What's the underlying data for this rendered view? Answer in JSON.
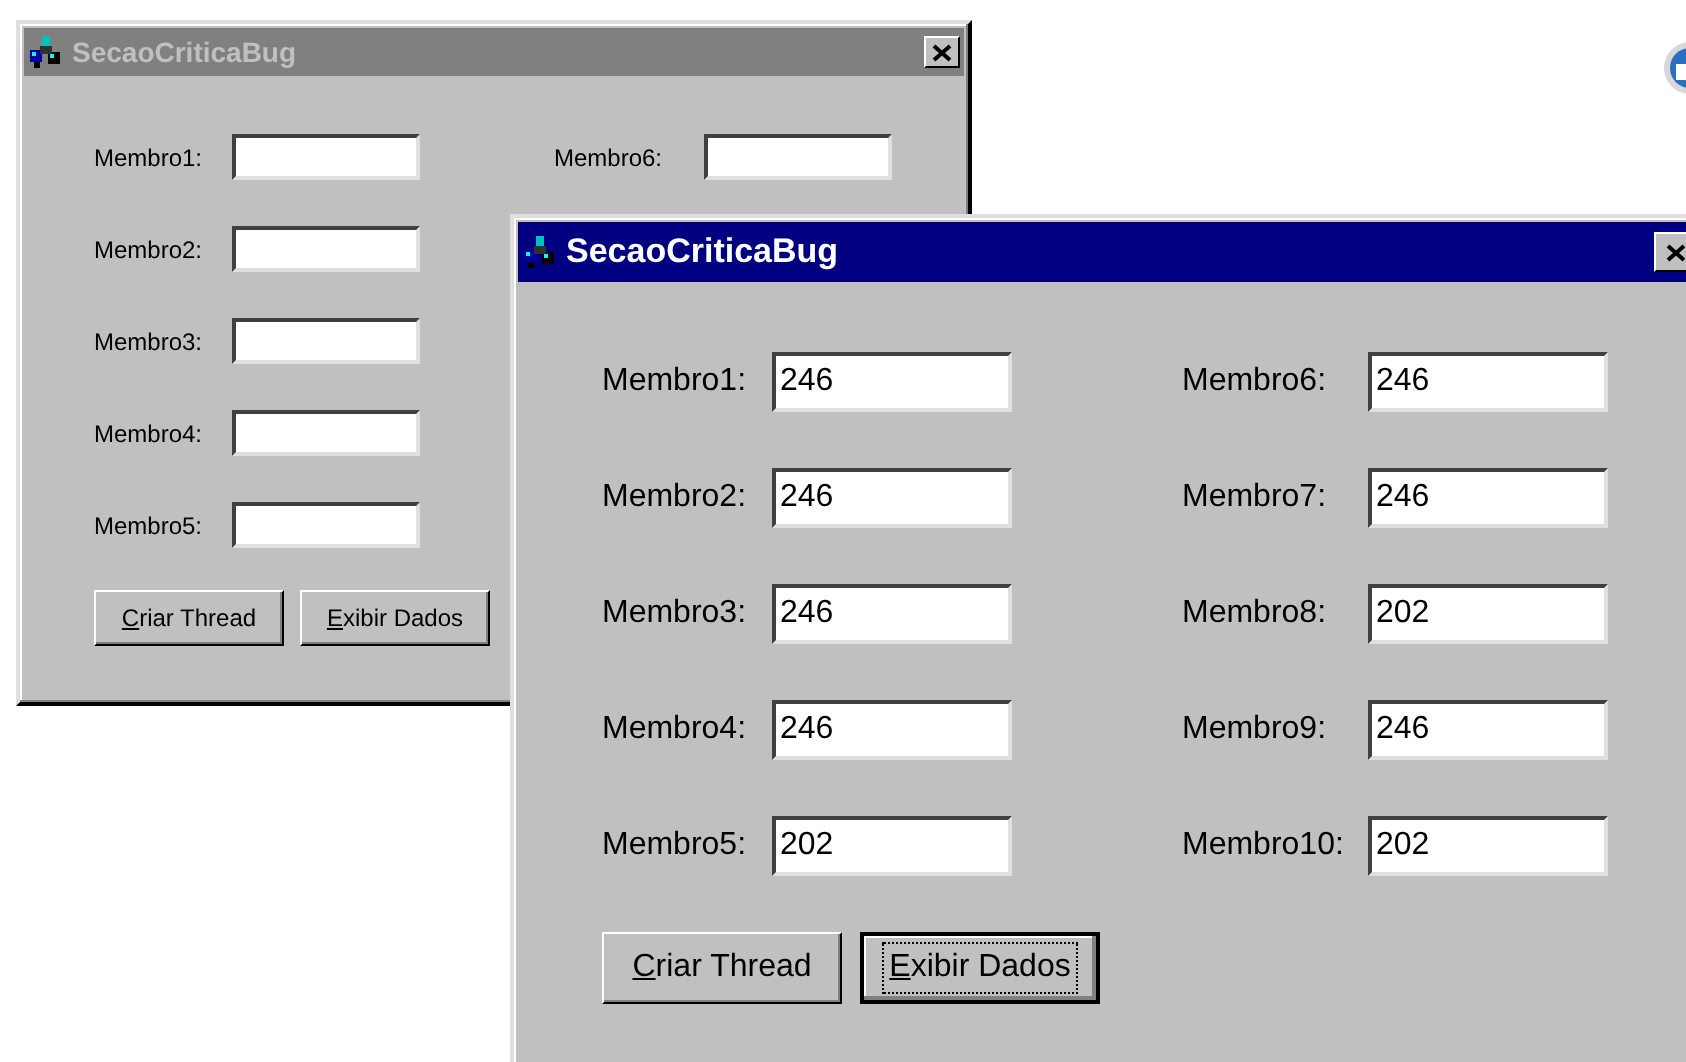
{
  "windows": [
    {
      "title": "SecaoCriticaBug",
      "active": false,
      "fields": [
        {
          "label": "Membro1:"
        },
        {
          "label": "Membro2:"
        },
        {
          "label": "Membro3:"
        },
        {
          "label": "Membro4:"
        },
        {
          "label": "Membro5:"
        },
        {
          "label": "Membro6:"
        }
      ],
      "buttons": [
        {
          "label": "Criar Thread",
          "focused": false
        },
        {
          "label": "Exibir Dados",
          "focused": false
        }
      ]
    },
    {
      "title": "SecaoCriticaBug",
      "active": true,
      "fields": [
        {
          "label": "Membro1:",
          "value": "246"
        },
        {
          "label": "Membro2:",
          "value": "246"
        },
        {
          "label": "Membro3:",
          "value": "246"
        },
        {
          "label": "Membro4:",
          "value": "246"
        },
        {
          "label": "Membro5:",
          "value": "202"
        },
        {
          "label": "Membro6:",
          "value": "246"
        },
        {
          "label": "Membro7:",
          "value": "246"
        },
        {
          "label": "Membro8:",
          "value": "202"
        },
        {
          "label": "Membro9:",
          "value": "246"
        },
        {
          "label": "Membro10:",
          "value": "202"
        }
      ],
      "buttons": [
        {
          "label": "Criar Thread",
          "focused": false
        },
        {
          "label": "Exibir Dados",
          "focused": true
        }
      ]
    }
  ]
}
